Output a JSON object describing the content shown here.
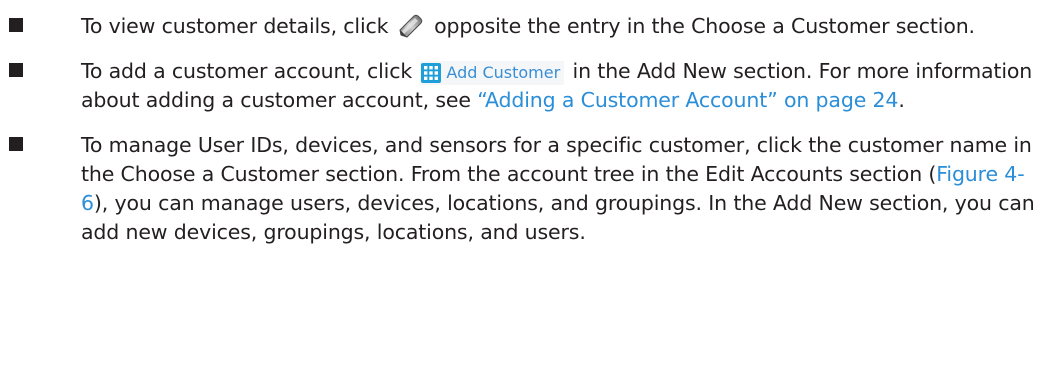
{
  "bullets": [
    {
      "text_before": "To view customer details, click ",
      "icon": "pencil-edit-icon",
      "text_after": " opposite the entry in the Choose a Customer section."
    },
    {
      "text_before": "To add a customer account, click ",
      "button_icon": "grid-icon",
      "button_label": "Add Customer",
      "text_middle": " in the Add New section. For more information about adding a customer account, see ",
      "link_text": "“Adding a Customer Account” on page 24",
      "text_after": "."
    },
    {
      "text_before": "To manage User IDs, devices, and sensors for a specific customer, click the customer name in the Choose a Customer section. From the account tree in the Edit Accounts section (",
      "link_text": "Figure 4-6",
      "text_after": "), you can manage users, devices, locations, and groupings. In the Add New section, you can add new devices, groupings, locations, and users."
    }
  ],
  "colors": {
    "text": "#231f20",
    "link": "#2a8ed8",
    "button_label": "#3a8fd4",
    "grid_icon": "#1e9fd8"
  }
}
